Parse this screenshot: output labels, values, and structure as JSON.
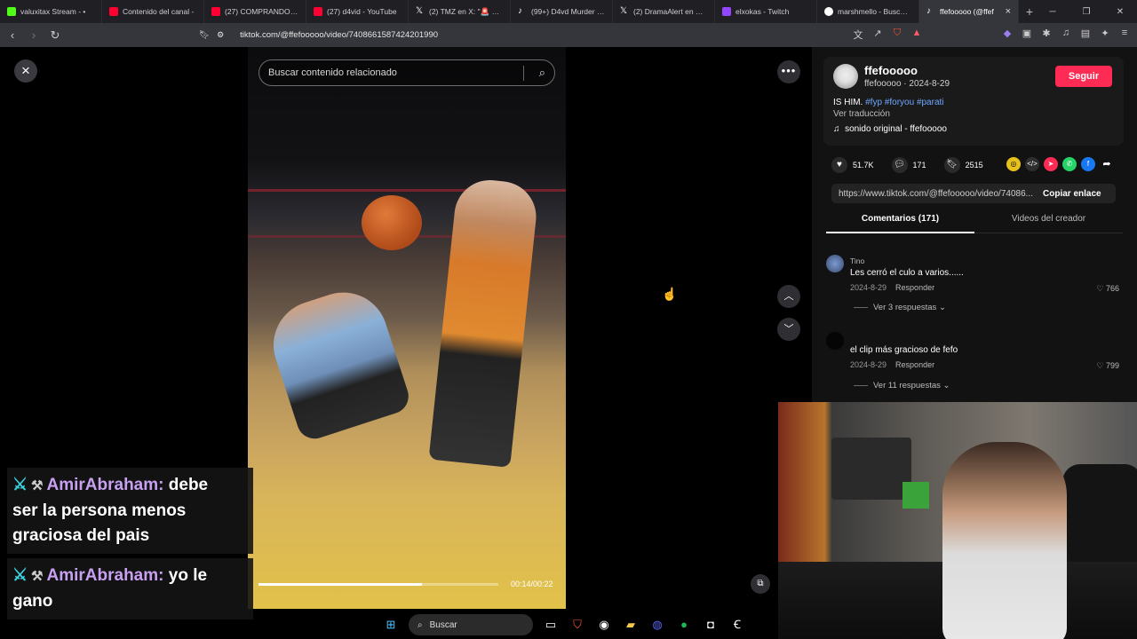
{
  "browser": {
    "tabs": [
      {
        "title": "valuxitax Stream - •",
        "color": "#53fc18"
      },
      {
        "title": "Contenido del canal -",
        "color": "#ff0033"
      },
      {
        "title": "(27) COMPRANDO EN",
        "color": "#ff0033"
      },
      {
        "title": "(27) d4vid - YouTube",
        "color": "#ff0033"
      },
      {
        "title": "(2) TMZ en X: \"🚨 BRE",
        "color": "#ffffff"
      },
      {
        "title": "(99+) D4vd Murder Cas",
        "color": "#ffffff"
      },
      {
        "title": "(2) DramaAlert en X: \"#",
        "color": "#ffffff"
      },
      {
        "title": "elxokas - Twitch",
        "color": "#9146ff"
      },
      {
        "title": "marshmello - Buscar c",
        "color": "#ffffff"
      },
      {
        "title": "ffefooooo (@ffef",
        "color": "#ffffff"
      }
    ],
    "url": "tiktok.com/@ffefooooo/video/7408661587424201990",
    "new_tab": "+"
  },
  "video": {
    "search_placeholder": "Buscar contenido relacionado",
    "time": "00:14/00:22",
    "progress": 0.68
  },
  "chat": [
    {
      "user": "AmirAbraham:",
      "lines": [
        "debe",
        "ser la persona menos",
        "graciosa del pais"
      ]
    },
    {
      "user": "AmirAbraham:",
      "lines": [
        "yo le",
        "gano"
      ]
    }
  ],
  "post": {
    "username": "ffefooooo",
    "subline": "ffefooooo · 2024-8-29",
    "follow": "Seguir",
    "caption": "IS HIM.",
    "hashtags": "#fyp #foryou #parati",
    "translate": "Ver traducción",
    "music": "sonido original - ffefooooo",
    "likes": "51.7K",
    "comments": "171",
    "saves": "2515",
    "link": "https://www.tiktok.com/@ffefooooo/video/74086...",
    "copy": "Copiar enlace"
  },
  "tabs": {
    "comments": "Comentarios (171)",
    "creator": "Videos del creador"
  },
  "comments": [
    {
      "name": "Tino",
      "text": "Les cerró el culo a varios......",
      "date": "2024-8-29",
      "reply": "Responder",
      "likes": "766",
      "replies": "Ver 3 respuestas"
    },
    {
      "name": "",
      "text": "el clip más gracioso de fefo",
      "date": "2024-8-29",
      "reply": "Responder",
      "likes": "799",
      "replies": "Ver 11 respuestas"
    }
  ],
  "taskbar": {
    "search": "Buscar"
  }
}
